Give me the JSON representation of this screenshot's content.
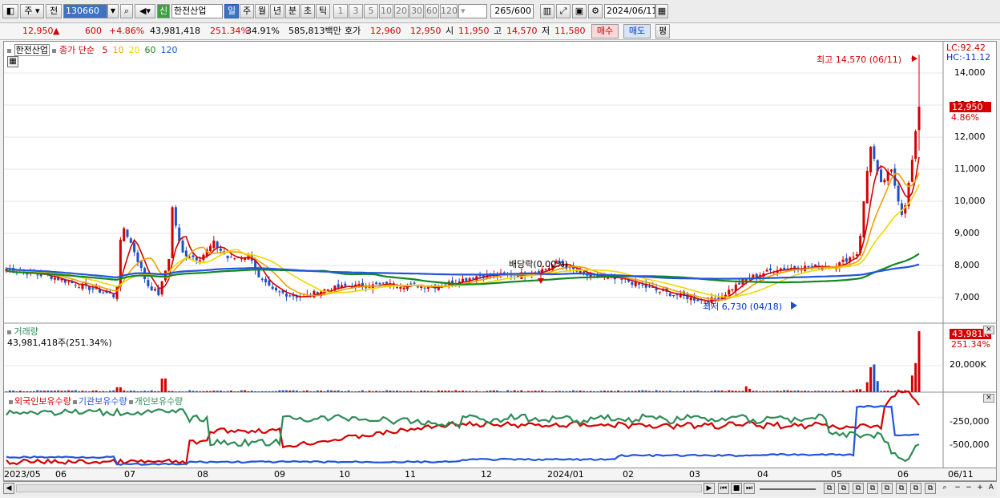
{
  "toolbar": {
    "market": "주",
    "prev": "전",
    "code": "130660",
    "stock_badge": "신",
    "stock_name": "한전산업",
    "periods": [
      {
        "label": "일",
        "active": true
      },
      {
        "label": "주"
      },
      {
        "label": "월"
      },
      {
        "label": "년"
      },
      {
        "label": "분"
      },
      {
        "label": "초"
      },
      {
        "label": "틱"
      }
    ],
    "intervals": [
      "1",
      "3",
      "5",
      "10",
      "20",
      "30",
      "60",
      "120"
    ],
    "count": "265",
    "count_max": "/600",
    "date": "2024/06/11"
  },
  "quote": {
    "price": "12,950",
    "arrow": "▲",
    "change": "600",
    "pct": "+4.86%",
    "volume": "43,981,418",
    "vol_ratio": "251.34%",
    "turnover": "34.91%",
    "amount": "585,813백만",
    "hoga_label": "호가",
    "hoga1": "12,960",
    "hoga2": "12,950",
    "open_label": "시",
    "open": "11,950",
    "high_label": "고",
    "high": "14,570",
    "low_label": "저",
    "low": "11,580",
    "buy": "매수",
    "sell": "매도",
    "avg": "평"
  },
  "legend": {
    "name": "한전산업",
    "close_label": "종가 단순",
    "ma": [
      "5",
      "10",
      "20",
      "60",
      "120"
    ],
    "ma_colors": [
      "#d40000",
      "#f0a000",
      "#f0d800",
      "#118822",
      "#2255dd"
    ]
  },
  "price_panel": {
    "lc": "LC:92.42",
    "hc": "HC:-11.12",
    "current": "12,950",
    "current_pct": "4.86%",
    "y_ticks": [
      "14,000",
      "13,000",
      "12,000",
      "11,000",
      "10,000",
      "9,000",
      "8,000",
      "7,000"
    ],
    "max_label": "최고 14,570 (06/11)",
    "min_label": "최저 6,730 (04/18)",
    "dividend_label": "배당락(0.00%)"
  },
  "volume_panel": {
    "title": "거래량",
    "value": "43,981,418주(251.34%)",
    "current": "43,981K",
    "pct": "251.34%",
    "tick": "20,000K"
  },
  "holding_panel": {
    "series": [
      "외국인보유수량",
      "기관보유수량",
      "개인보유수량"
    ],
    "colors": [
      "#d40000",
      "#2255dd",
      "#2e8b57"
    ],
    "y_ticks": [
      "-250,000",
      "-500,000"
    ]
  },
  "x_axis": {
    "labels": [
      "2023/05",
      "06",
      "07",
      "08",
      "09",
      "10",
      "11",
      "12",
      "2024/01",
      "02",
      "03",
      "04",
      "05",
      "06",
      "06/11"
    ]
  },
  "chart_data": {
    "type": "candlestick",
    "x_range": [
      "2023/05",
      "2024/06/11"
    ],
    "y_range": [
      6500,
      15000
    ],
    "close_key_points": [
      {
        "x": "2023/05",
        "y": 7900
      },
      {
        "x": "2023/07",
        "y": 7000
      },
      {
        "x": "2023/07",
        "y": 9200
      },
      {
        "x": "2023/08",
        "y": 7100
      },
      {
        "x": "2023/08",
        "y": 8800
      },
      {
        "x": "2023/09",
        "y": 8300
      },
      {
        "x": "2023/10",
        "y": 7200
      },
      {
        "x": "2023/11",
        "y": 7000
      },
      {
        "x": "2024/01",
        "y": 7300
      },
      {
        "x": "2024/02",
        "y": 7700
      },
      {
        "x": "2024/03",
        "y": 7600
      },
      {
        "x": "2024/04",
        "y": 6900
      },
      {
        "x": "2024/05",
        "y": 7700
      },
      {
        "x": "2024/05",
        "y": 8000
      },
      {
        "x": "2024/06",
        "y": 11800
      },
      {
        "x": "2024/06",
        "y": 9500
      },
      {
        "x": "2024/06/11",
        "y": 12950
      }
    ],
    "high": 14570,
    "low": 6730
  }
}
